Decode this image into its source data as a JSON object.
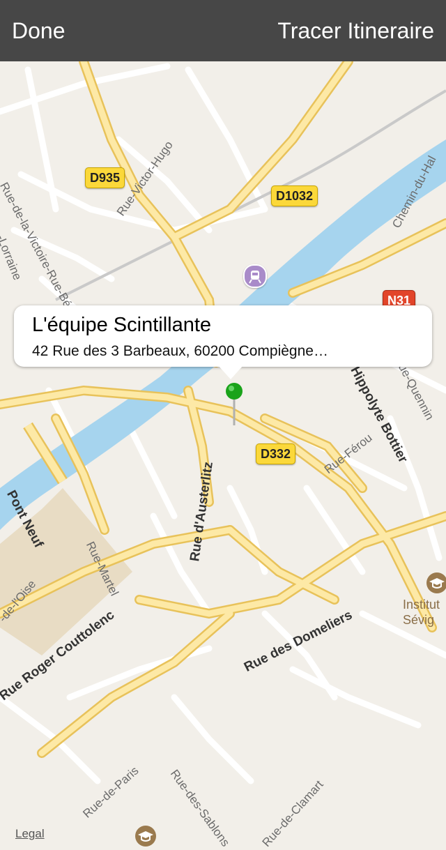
{
  "nav": {
    "done_label": "Done",
    "route_label": "Tracer Itineraire"
  },
  "callout": {
    "title": "L'équipe Scintillante",
    "subtitle": "42 Rue des 3 Barbeaux, 60200 Compiègne…"
  },
  "shields": {
    "d935": "D935",
    "d1032": "D1032",
    "n31": "N31",
    "d332": "D332"
  },
  "streets": {
    "victor_hugo": "Rue-Victor-Hugo",
    "victoire": "Rue-de-la-Victoire-Rue-Béranger",
    "lorraine": "-Lorraine",
    "chemin_halage": "Chemin-du-Hal",
    "hippolyte": "Rue Hippolyte Bottier",
    "quennin": "Rue-Quennin",
    "ferou": "Rue-Férou",
    "pont_neuf": "Pont Neuf",
    "austerlitz": "Rue d'Austerlitz",
    "martel": "Rue-Martel",
    "oise": "-de-l'Oise",
    "roger": "Rue Roger Couttolenc",
    "domeliers": "Rue des Domeliers",
    "paris": "Rue-de-Paris",
    "sablons": "Rue-des-Sablons",
    "clamart": "Rue-de-Clamart"
  },
  "poi": {
    "institut_line1": "Institut",
    "institut_line2": "Sévig"
  },
  "legal": "Legal",
  "colors": {
    "water": "#a6d4ee",
    "road": "#fde9a6",
    "road_edge": "#e8c25a",
    "land": "#f2efe9",
    "park": "#e8dcc4",
    "pin": "#1aa31a",
    "shield_yellow": "#fbd83a",
    "shield_red": "#e2452a"
  },
  "icons": [
    "train-station-icon",
    "school-icon",
    "pin-icon"
  ]
}
